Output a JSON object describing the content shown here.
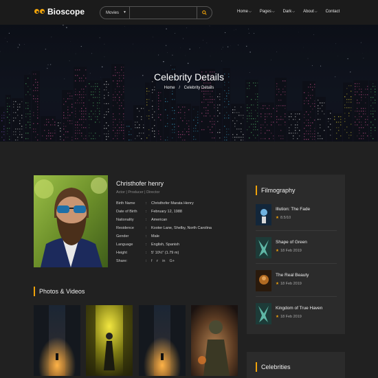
{
  "brand": {
    "name": "Bioscope"
  },
  "search": {
    "category": "Movies",
    "placeholder": "",
    "value": ""
  },
  "menu": [
    {
      "label": "Home",
      "has_dropdown": true
    },
    {
      "label": "Pages",
      "has_dropdown": true
    },
    {
      "label": "Dark",
      "has_dropdown": true
    },
    {
      "label": "About",
      "has_dropdown": true
    },
    {
      "label": "Contact",
      "has_dropdown": false
    }
  ],
  "hero": {
    "title": "Celebrity Details",
    "breadcrumb": {
      "home": "Home",
      "separator": "/",
      "current": "Celebrity Details"
    }
  },
  "profile": {
    "name": "Christhofer henry",
    "roles": "Actor | Producer | Director",
    "fields": [
      {
        "label": "Birth Name",
        "value": "Christhofer Marata Henry"
      },
      {
        "label": "Date of Birth",
        "value": "February 12, 1988"
      },
      {
        "label": "Nationality",
        "value": "American"
      },
      {
        "label": "Residence",
        "value": "Kooter Lane, Shelby, North Carolina"
      },
      {
        "label": "Gender",
        "value": "Male"
      },
      {
        "label": "Language",
        "value": "English, Spanish"
      },
      {
        "label": "Height",
        "value": "5' 10½\" (1.79 m)"
      }
    ],
    "share_label": "Share:",
    "share_icons": [
      "facebook-icon",
      "twitter-icon",
      "linkedin-icon",
      "google-plus-icon"
    ]
  },
  "photos_section": {
    "title": "Photos & Videos"
  },
  "filmography": {
    "title": "Filmography",
    "items": [
      {
        "title": "Illution: The Fade",
        "meta": "8.5/10",
        "meta_type": "rating"
      },
      {
        "title": "Shape of Green",
        "meta": "18 Feb 2019",
        "meta_type": "date"
      },
      {
        "title": "The Real Beauty",
        "meta": "18 Feb 2019",
        "meta_type": "date"
      },
      {
        "title": "Kingdom of True Haven",
        "meta": "18 Feb 2019",
        "meta_type": "date"
      }
    ]
  },
  "celebrities": {
    "title": "Celebrities"
  },
  "colors": {
    "accent": "#f0a30a",
    "background": "#212121",
    "panel": "#2b2b2b"
  }
}
